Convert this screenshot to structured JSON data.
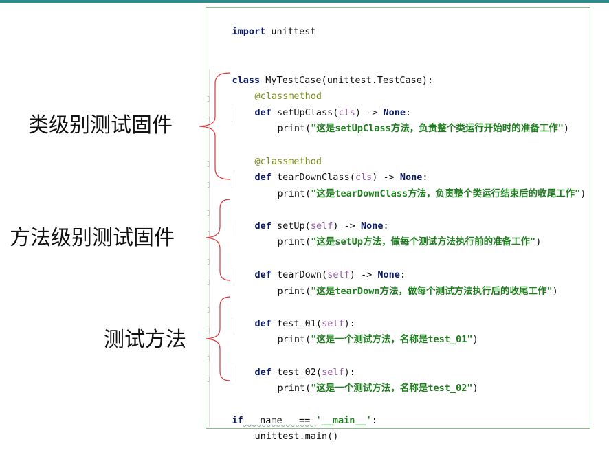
{
  "colors": {
    "top_bar": "#2e8b8b",
    "panel_border": "#8fb98f",
    "brace": "#d9363e",
    "keyword": "#0a1a66",
    "string": "#1d7d1d",
    "decorator": "#7f8c1c",
    "param": "#9a5aa8"
  },
  "labels": {
    "class_fixture": "类级别测试固件",
    "method_fixture": "方法级别测试固件",
    "test_methods": "测试方法"
  },
  "code": {
    "l1_kw": "import",
    "l1_rest": " unittest",
    "l2_kw": "class",
    "l2_rest": " MyTestCase(unittest.TestCase):",
    "l3_dec": "@classmethod",
    "l4_kw": "def",
    "l4_fn": " setUpClass(",
    "l4_param": "cls",
    "l4_mid": ") -> ",
    "l4_none": "None",
    "l4_end": ":",
    "l5_fn": "print(",
    "l5_str": "\"这是setUpClass方法，负责整个类运行开始时的准备工作\"",
    "l5_end": ")",
    "l6_dec": "@classmethod",
    "l7_kw": "def",
    "l7_fn": " tearDownClass(",
    "l7_param": "cls",
    "l7_mid": ") -> ",
    "l7_none": "None",
    "l7_end": ":",
    "l8_fn": "print(",
    "l8_str": "\"这是tearDownClass方法，负责整个类运行结束后的收尾工作\"",
    "l8_end": ")",
    "l9_kw": "def",
    "l9_fn": " setUp(",
    "l9_param": "self",
    "l9_mid": ") -> ",
    "l9_none": "None",
    "l9_end": ":",
    "l10_fn": "print(",
    "l10_str": "\"这是setUp方法，做每个测试方法执行前的准备工作\"",
    "l10_end": ")",
    "l11_kw": "def",
    "l11_fn": " tearDown(",
    "l11_param": "self",
    "l11_mid": ") -> ",
    "l11_none": "None",
    "l11_end": ":",
    "l12_fn": "print(",
    "l12_str": "\"这是tearDown方法，做每个测试方法执行后的收尾工作\"",
    "l12_end": ")",
    "l13_kw": "def",
    "l13_fn": " test_01(",
    "l13_param": "self",
    "l13_end": "):",
    "l14_fn": "print(",
    "l14_str": "\"这是一个测试方法，名称是test_01\"",
    "l14_end": ")",
    "l15_kw": "def",
    "l15_fn": " test_02(",
    "l15_param": "self",
    "l15_end": "):",
    "l16_fn": "print(",
    "l16_str": "\"这是一个测试方法，名称是test_02\"",
    "l16_end": ")",
    "l17_kw": "if",
    "l17_mid": " __name__ == ",
    "l17_str": "'__main__'",
    "l17_end": ":",
    "l18_fn": "unittest.main()"
  }
}
